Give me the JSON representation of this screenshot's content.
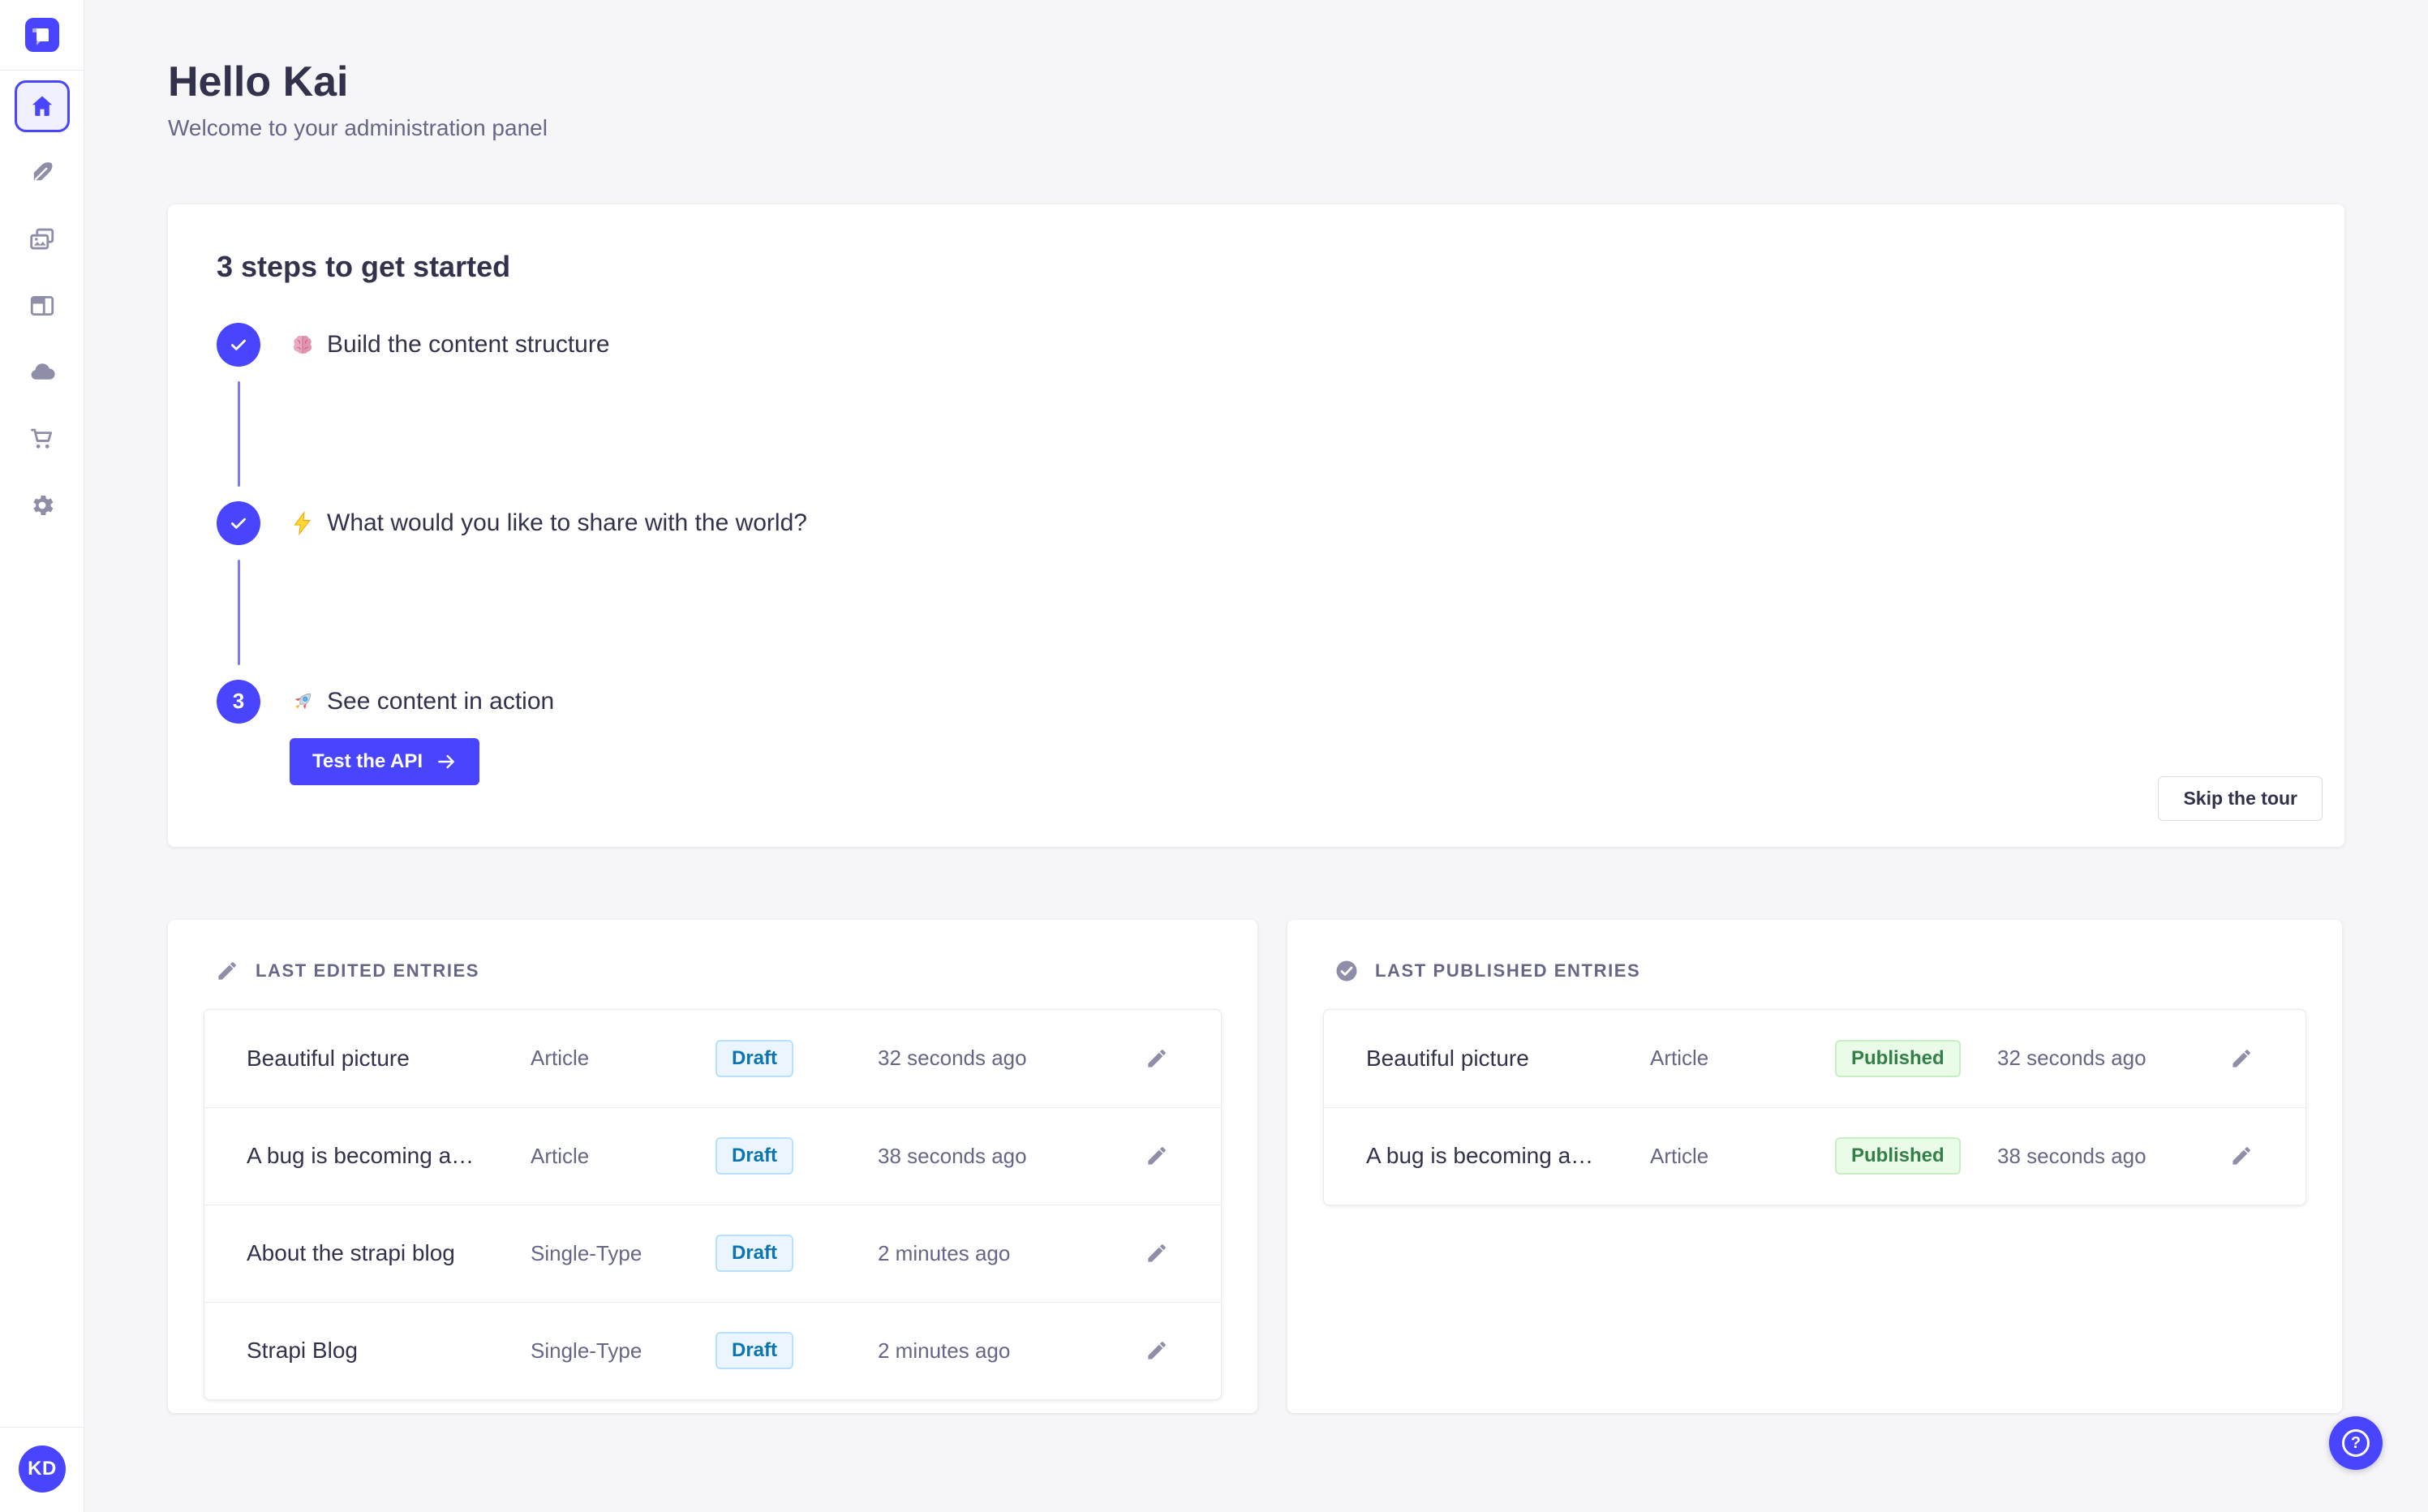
{
  "colors": {
    "primary": "#4945ff",
    "primary_light": "#f0f0ff",
    "connector": "#7b79ff",
    "background": "#f6f6f9",
    "surface": "#ffffff",
    "text_main": "#32324d",
    "text_secondary": "#666687",
    "icon_gray": "#8e8ea9",
    "divider": "#eaeaef",
    "draft_bg": "#eaf5ff",
    "draft_border": "#b8e1ff",
    "draft_text": "#0c75af",
    "published_bg": "#eafbe7",
    "published_border": "#c6f0c2",
    "published_text": "#328048"
  },
  "sidebar": {
    "logo_icon": "strapi-logo",
    "items": [
      {
        "icon": "home-icon",
        "active": true
      },
      {
        "icon": "feather-icon",
        "active": false
      },
      {
        "icon": "media-library-icon",
        "active": false
      },
      {
        "icon": "layout-icon",
        "active": false
      },
      {
        "icon": "cloud-icon",
        "active": false
      },
      {
        "icon": "cart-icon",
        "active": false
      },
      {
        "icon": "gear-icon",
        "active": false
      }
    ],
    "avatar_initials": "KD"
  },
  "header": {
    "title": "Hello Kai",
    "subtitle": "Welcome to your administration panel"
  },
  "onboarding": {
    "title": "3 steps to get started",
    "steps": [
      {
        "number": "1",
        "state": "done",
        "emoji": "brain-emoji",
        "label": "Build the content structure"
      },
      {
        "number": "2",
        "state": "done",
        "emoji": "zap-emoji",
        "label": "What would you like to share with the world?"
      },
      {
        "number": "3",
        "state": "current",
        "emoji": "rocket-emoji",
        "label": "See content in action",
        "cta": "Test the API",
        "cta_icon": "arrow-right-icon"
      }
    ],
    "skip_label": "Skip the tour"
  },
  "last_edited": {
    "icon": "pencil-icon",
    "title": "LAST EDITED ENTRIES",
    "rows": [
      {
        "title": "Beautiful picture",
        "type": "Article",
        "status": "Draft",
        "time": "32 seconds ago"
      },
      {
        "title": "A bug is becoming a…",
        "type": "Article",
        "status": "Draft",
        "time": "38 seconds ago"
      },
      {
        "title": "About the strapi blog",
        "type": "Single-Type",
        "status": "Draft",
        "time": "2 minutes ago"
      },
      {
        "title": "Strapi Blog",
        "type": "Single-Type",
        "status": "Draft",
        "time": "2 minutes ago"
      }
    ]
  },
  "last_published": {
    "icon": "check-circle-icon",
    "title": "LAST PUBLISHED ENTRIES",
    "rows": [
      {
        "title": "Beautiful picture",
        "type": "Article",
        "status": "Published",
        "time": "32 seconds ago"
      },
      {
        "title": "A bug is becoming a…",
        "type": "Article",
        "status": "Published",
        "time": "38 seconds ago"
      }
    ]
  },
  "help": {
    "icon_label": "?"
  }
}
